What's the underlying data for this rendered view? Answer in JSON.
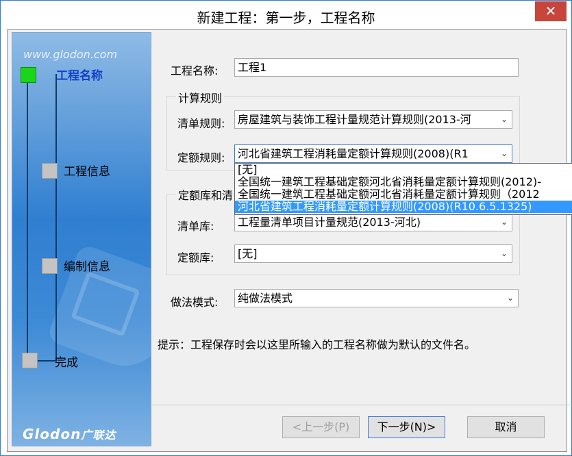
{
  "window": {
    "title": "新建工程：第一步，工程名称",
    "close_symbol": "✕"
  },
  "sidebar": {
    "url": "www.glodon.com",
    "steps": [
      {
        "label": "工程名称",
        "active": true
      },
      {
        "label": "工程信息",
        "active": false
      },
      {
        "label": "编制信息",
        "active": false
      },
      {
        "label": "完成",
        "active": false
      }
    ],
    "logo": "Glodon",
    "logo_cn": "广联达"
  },
  "form": {
    "project_name_label": "工程名称:",
    "project_name_value": "工程1",
    "calc_rules_title": "计算规则",
    "list_rule_label": "清单规则:",
    "list_rule_value": "房屋建筑与装饰工程计量规范计算规则(2013-河",
    "quota_rule_label": "定额规则:",
    "quota_rule_value": "河北省建筑工程消耗量定额计算规则(2008)(R1",
    "lib_group_title": "定额库和清",
    "list_lib_label": "清单库:",
    "list_lib_value": "工程量清单项目计量规范(2013-河北)",
    "quota_lib_label": "定额库:",
    "quota_lib_value": "[无]",
    "method_label": "做法模式:",
    "method_value": "纯做法模式"
  },
  "dropdown": {
    "items": [
      {
        "label": "[无]",
        "selected": false
      },
      {
        "label": "全国统一建筑工程基础定额河北省消耗量定额计算规则(2012)-",
        "selected": false
      },
      {
        "label": "全国统一建筑工程基础定额河北省消耗量定额计算规则（2012",
        "selected": false
      },
      {
        "label": "河北省建筑工程消耗量定额计算规则(2008)(R10.6.5.1325)",
        "selected": true
      }
    ]
  },
  "hint": "提示：工程保存时会以这里所输入的工程名称做为默认的文件名。",
  "buttons": {
    "prev": "<上一步(P)",
    "next": "下一步(N)>",
    "cancel": "取消"
  },
  "icons": {
    "combo_arrow": "⌄"
  }
}
